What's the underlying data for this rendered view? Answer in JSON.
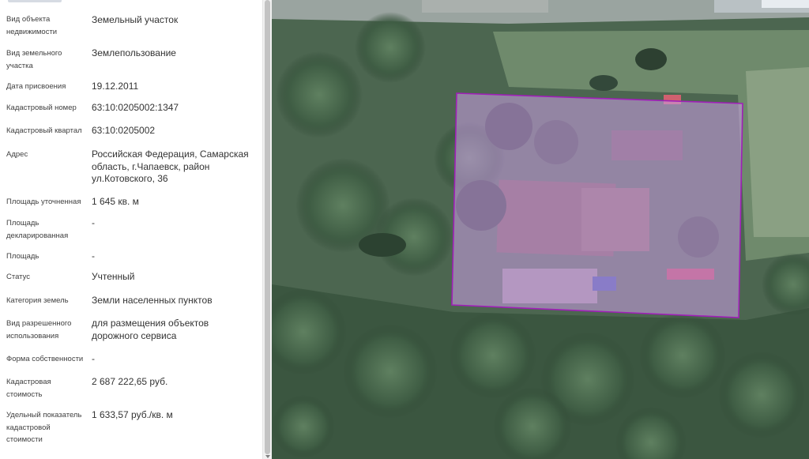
{
  "colors": {
    "parcel_fill": "#b98fd3",
    "parcel_stroke": "#a01fb8",
    "panel_bg": "#ffffff",
    "label_text": "#404040",
    "value_text": "#333333"
  },
  "icons": [
    "scroll-down-arrow-icon"
  ],
  "details": [
    {
      "label": "Вид объекта недвижимости",
      "value": "Земельный участок"
    },
    {
      "label": "Вид земельного участка",
      "value": "Землепользование"
    },
    {
      "label": "Дата присвоения",
      "value": "19.12.2011"
    },
    {
      "label": "Кадастровый номер",
      "value": "63:10:0205002:1347"
    },
    {
      "label": "Кадастровый квартал",
      "value": "63:10:0205002"
    },
    {
      "label": "Адрес",
      "value": "Российская Федерация, Самарская область, г.Чапаевск, район ул.Котовского, 36"
    },
    {
      "label": "Площадь уточненная",
      "value": "1 645 кв. м"
    },
    {
      "label": "Площадь декларированная",
      "value": "-"
    },
    {
      "label": "Площадь",
      "value": "-"
    },
    {
      "label": "Статус",
      "value": "Учтенный"
    },
    {
      "label": "Категория земель",
      "value": "Земли населенных пунктов"
    },
    {
      "label": "Вид разрешенного использования",
      "value": "для размещения объектов дорожного сервиса"
    },
    {
      "label": "Форма собственности",
      "value": "-"
    },
    {
      "label": "Кадастровая стоимость",
      "value": "2 687 222,65 руб."
    },
    {
      "label": "Удельный показатель кадастровой стоимости",
      "value": "1 633,57 руб./кв. м"
    }
  ]
}
